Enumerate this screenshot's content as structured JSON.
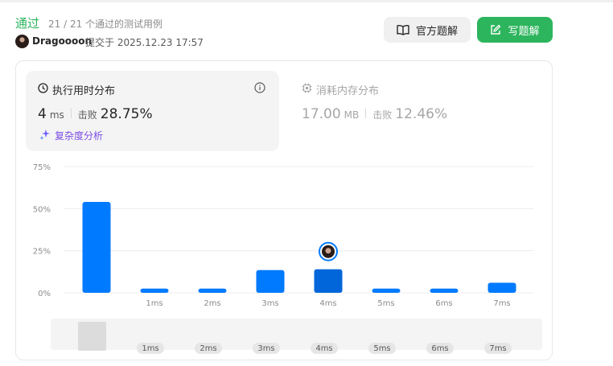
{
  "header": {
    "status": "通过",
    "cases": "21 / 21 个通过的测试用例",
    "username": "Dragoooon",
    "submitted": "提交于 2025.12.23 17:57"
  },
  "buttons": {
    "official_solution": "官方题解",
    "write_solution": "写题解"
  },
  "runtime": {
    "title": "执行用时分布",
    "value": "4",
    "unit": "ms",
    "beats_label": "击败",
    "beats_pct": "28.75%",
    "complexity_link": "复杂度分析"
  },
  "memory": {
    "title": "消耗内存分布",
    "value": "17.00",
    "unit": "MB",
    "beats_label": "击败",
    "beats_pct": "12.46%"
  },
  "colors": {
    "accept": "#2db55d",
    "bar": "#007aff",
    "bar_selected": "#0066d9",
    "complexity": "#7b4ce6"
  },
  "chart_data": {
    "type": "bar",
    "y_ticks": [
      "75%",
      "50%",
      "25%",
      "0%"
    ],
    "ylim": [
      0,
      75
    ],
    "categories": [
      "",
      "1ms",
      "2ms",
      "3ms",
      "4ms",
      "5ms",
      "6ms",
      "7ms"
    ],
    "values": [
      54,
      2.5,
      2.5,
      13.5,
      14,
      2.5,
      2.5,
      6
    ],
    "selected_category": "4ms",
    "grid": true
  },
  "mini_chart": {
    "labels": [
      "1ms",
      "2ms",
      "3ms",
      "4ms",
      "5ms",
      "6ms",
      "7ms"
    ]
  }
}
